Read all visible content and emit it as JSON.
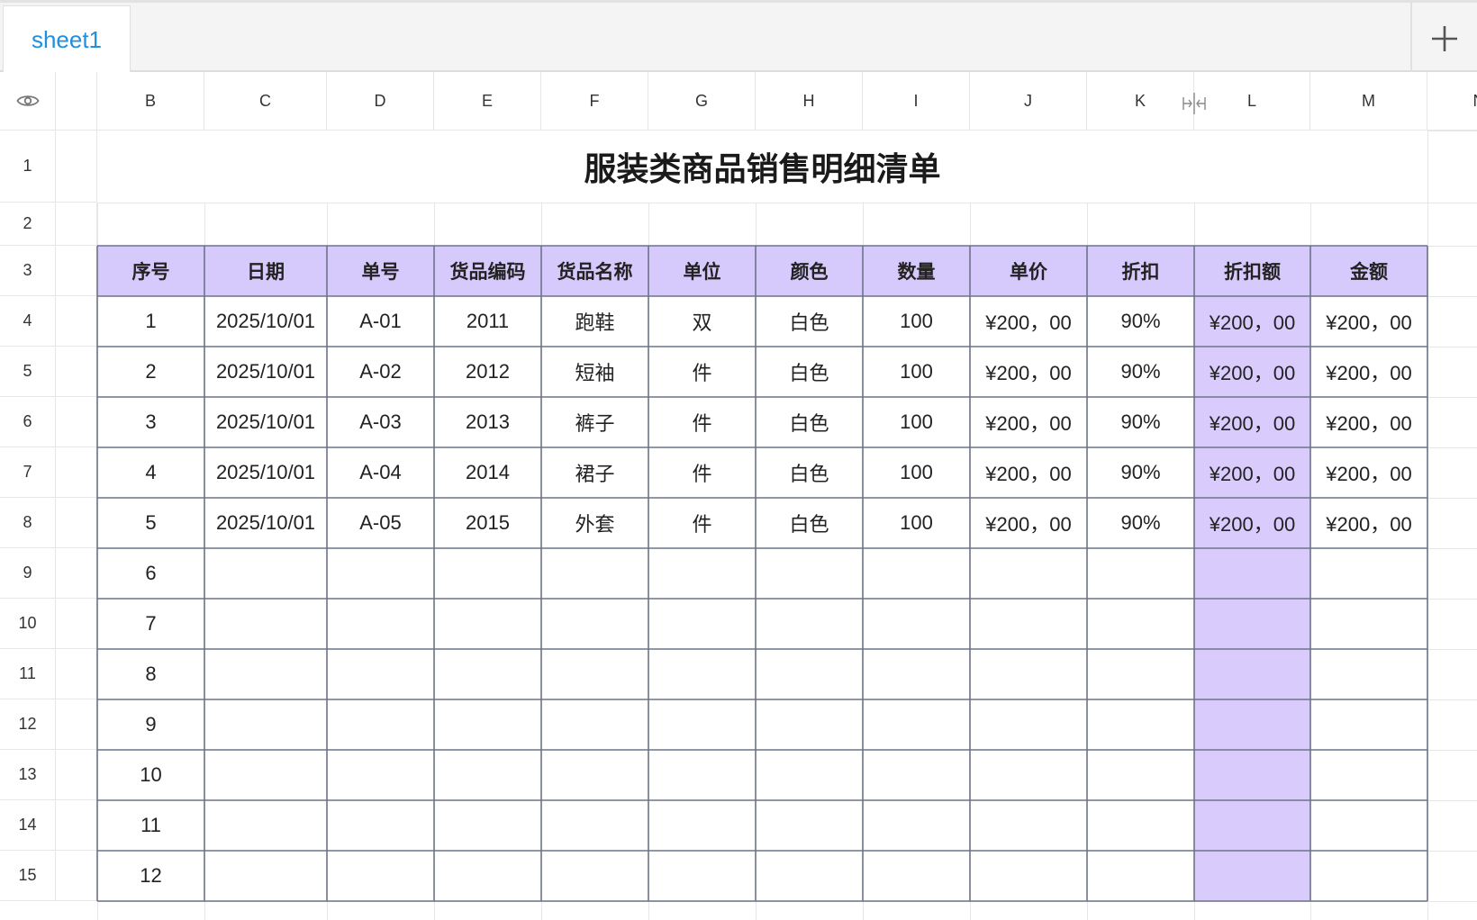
{
  "tabs": {
    "active": "sheet1"
  },
  "icons": {
    "add": "plus-icon",
    "visibility": "eye-icon",
    "column_resize": "column-resize-icon"
  },
  "colors": {
    "accent_tab": "#1f8fe0",
    "header_fill": "#d6c9fb",
    "highlight_column": "#d9ccfd",
    "table_border": "#6d7389"
  },
  "columns": [
    "B",
    "C",
    "D",
    "E",
    "F",
    "G",
    "H",
    "I",
    "J",
    "K",
    "L",
    "M",
    "N"
  ],
  "rows": [
    "1",
    "2",
    "3",
    "4",
    "5",
    "6",
    "7",
    "8",
    "9",
    "10",
    "11",
    "12",
    "13",
    "14",
    "15"
  ],
  "title": "服装类商品销售明细清单",
  "table": {
    "headers": [
      "序号",
      "日期",
      "单号",
      "货品编码",
      "货品名称",
      "单位",
      "颜色",
      "数量",
      "单价",
      "折扣",
      "折扣额",
      "金额"
    ],
    "rows": [
      [
        "1",
        "2025/10/01",
        "A-01",
        "2011",
        "跑鞋",
        "双",
        "白色",
        "100",
        "¥200，00",
        "90%",
        "¥200，00",
        "¥200，00"
      ],
      [
        "2",
        "2025/10/01",
        "A-02",
        "2012",
        "短袖",
        "件",
        "白色",
        "100",
        "¥200，00",
        "90%",
        "¥200，00",
        "¥200，00"
      ],
      [
        "3",
        "2025/10/01",
        "A-03",
        "2013",
        "裤子",
        "件",
        "白色",
        "100",
        "¥200，00",
        "90%",
        "¥200，00",
        "¥200，00"
      ],
      [
        "4",
        "2025/10/01",
        "A-04",
        "2014",
        "裙子",
        "件",
        "白色",
        "100",
        "¥200，00",
        "90%",
        "¥200，00",
        "¥200，00"
      ],
      [
        "5",
        "2025/10/01",
        "A-05",
        "2015",
        "外套",
        "件",
        "白色",
        "100",
        "¥200，00",
        "90%",
        "¥200，00",
        "¥200，00"
      ],
      [
        "6",
        "",
        "",
        "",
        "",
        "",
        "",
        "",
        "",
        "",
        "",
        ""
      ],
      [
        "7",
        "",
        "",
        "",
        "",
        "",
        "",
        "",
        "",
        "",
        "",
        ""
      ],
      [
        "8",
        "",
        "",
        "",
        "",
        "",
        "",
        "",
        "",
        "",
        "",
        ""
      ],
      [
        "9",
        "",
        "",
        "",
        "",
        "",
        "",
        "",
        "",
        "",
        "",
        ""
      ],
      [
        "10",
        "",
        "",
        "",
        "",
        "",
        "",
        "",
        "",
        "",
        "",
        ""
      ],
      [
        "11",
        "",
        "",
        "",
        "",
        "",
        "",
        "",
        "",
        "",
        "",
        ""
      ],
      [
        "12",
        "",
        "",
        "",
        "",
        "",
        "",
        "",
        "",
        "",
        "",
        ""
      ]
    ]
  }
}
